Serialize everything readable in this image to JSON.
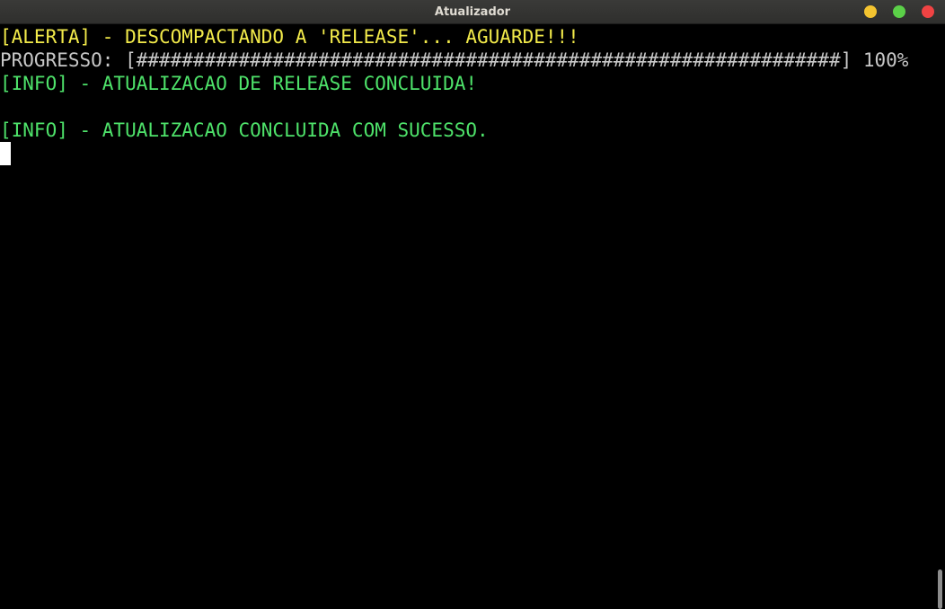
{
  "window": {
    "title": "Atualizador",
    "colors": {
      "minimize": "#f4c430",
      "maximize": "#5bd048",
      "close": "#f04343"
    }
  },
  "terminal": {
    "lines": [
      {
        "text": "[ALERTA] - DESCOMPACTANDO A 'RELEASE'... AGUARDE!!!",
        "color": "#f2ea4a"
      },
      {
        "text": "PROGRESSO: [##############################################################] 100%",
        "color": "#c8c8c8"
      },
      {
        "text": "[INFO] - ATUALIZACAO DE RELEASE CONCLUIDA!",
        "color": "#4ee26a"
      },
      {
        "text": "",
        "color": "#4ee26a"
      },
      {
        "text": "[INFO] - ATUALIZACAO CONCLUIDA COM SUCESSO.",
        "color": "#4ee26a"
      }
    ]
  }
}
